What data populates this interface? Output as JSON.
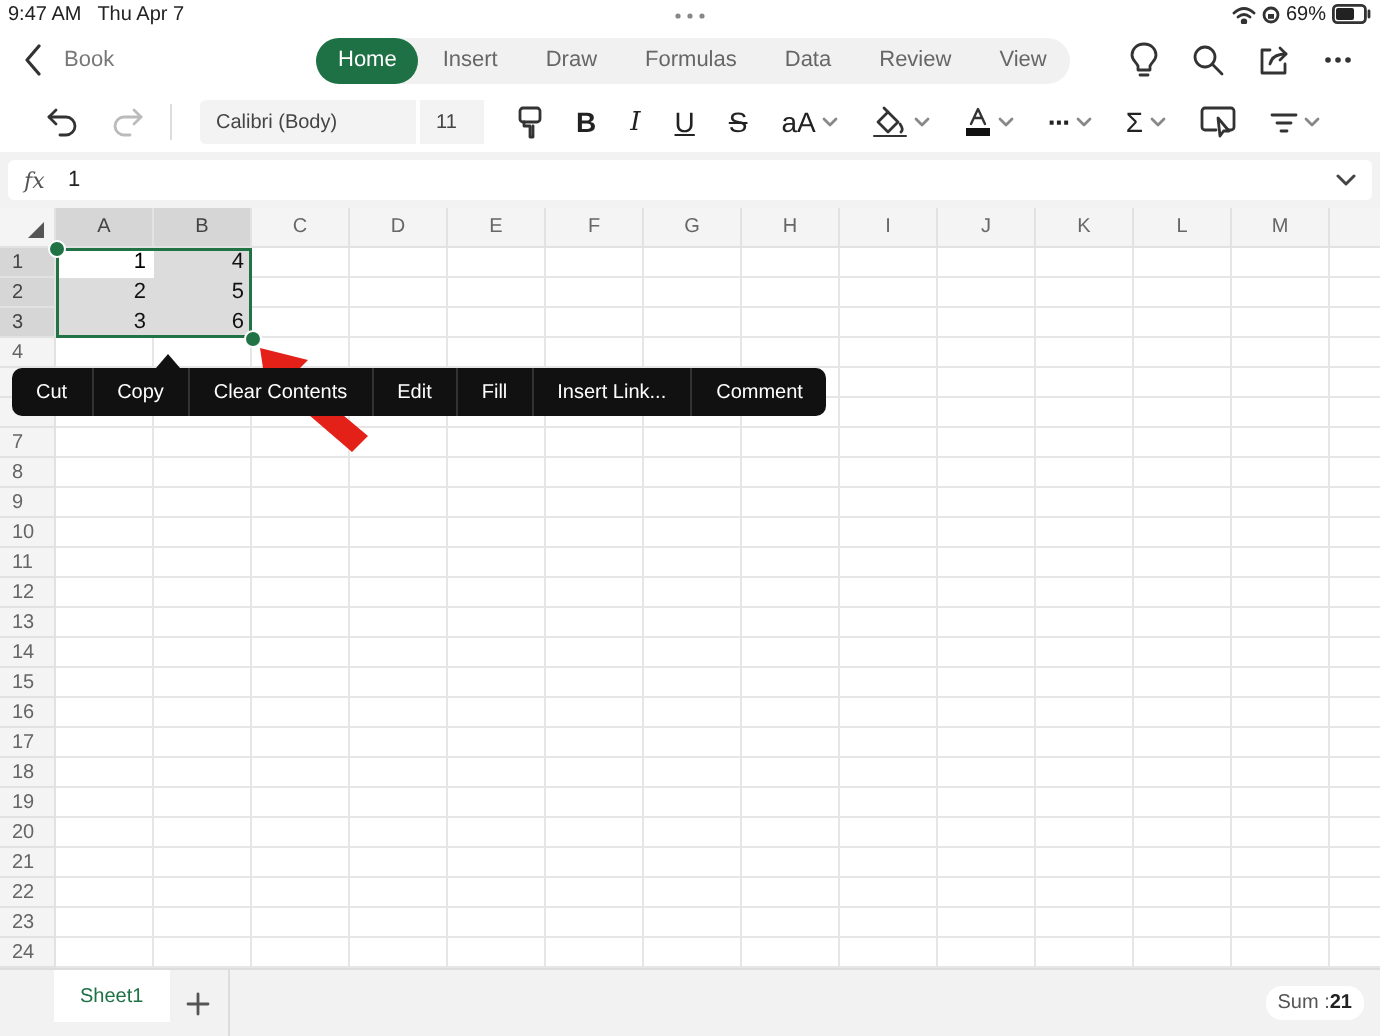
{
  "status_bar": {
    "time": "9:47 AM",
    "date": "Thu Apr 7",
    "battery": "69%"
  },
  "header": {
    "back_label": "Book",
    "tabs": [
      {
        "label": "Home",
        "selected": true
      },
      {
        "label": "Insert",
        "selected": false
      },
      {
        "label": "Draw",
        "selected": false
      },
      {
        "label": "Formulas",
        "selected": false
      },
      {
        "label": "Data",
        "selected": false
      },
      {
        "label": "Review",
        "selected": false
      },
      {
        "label": "View",
        "selected": false
      }
    ]
  },
  "toolbar": {
    "font": "Calibri (Body)",
    "size": "11",
    "items": [
      {
        "kind": "undo",
        "disabled": false
      },
      {
        "kind": "redo",
        "disabled": true
      },
      {
        "kind": "painter"
      },
      {
        "kind": "bold",
        "label": "B"
      },
      {
        "kind": "italic",
        "label": "I"
      },
      {
        "kind": "underline",
        "label": "U"
      },
      {
        "kind": "strike",
        "label": "S"
      },
      {
        "kind": "case",
        "label": "aA"
      },
      {
        "kind": "fill"
      },
      {
        "kind": "fontcolor"
      },
      {
        "kind": "more",
        "label": "···"
      },
      {
        "kind": "sum",
        "label": "Σ"
      },
      {
        "kind": "select"
      },
      {
        "kind": "filter"
      }
    ]
  },
  "formula_bar": {
    "label": "fx",
    "value": "1"
  },
  "sheet": {
    "columns": [
      {
        "label": "A",
        "selected": true
      },
      {
        "label": "B",
        "selected": true
      },
      {
        "label": "C",
        "selected": false
      },
      {
        "label": "D",
        "selected": false
      },
      {
        "label": "E",
        "selected": false
      },
      {
        "label": "F",
        "selected": false
      },
      {
        "label": "G",
        "selected": false
      },
      {
        "label": "H",
        "selected": false
      },
      {
        "label": "I",
        "selected": false
      },
      {
        "label": "J",
        "selected": false
      },
      {
        "label": "K",
        "selected": false
      },
      {
        "label": "L",
        "selected": false
      },
      {
        "label": "M",
        "selected": false
      }
    ],
    "rows": [
      {
        "header": "1",
        "selected": true,
        "cells": [
          {
            "value": "1",
            "active": true
          },
          {
            "value": "4",
            "active": false
          }
        ]
      },
      {
        "header": "2",
        "selected": true,
        "cells": [
          {
            "value": "2",
            "active": false
          },
          {
            "value": "5",
            "active": false
          }
        ]
      },
      {
        "header": "3",
        "selected": true,
        "cells": [
          {
            "value": "3",
            "active": false
          },
          {
            "value": "6",
            "active": false
          }
        ]
      },
      {
        "header": "4",
        "selected": false
      },
      {
        "selected": false
      },
      {
        "selected": false
      },
      {
        "header": "7",
        "selected": false
      },
      {
        "header": "8",
        "selected": false
      },
      {
        "header": "9",
        "selected": false
      },
      {
        "header": "10",
        "selected": false
      },
      {
        "header": "11",
        "selected": false
      },
      {
        "header": "12",
        "selected": false
      },
      {
        "header": "13",
        "selected": false
      },
      {
        "header": "14",
        "selected": false
      },
      {
        "header": "15",
        "selected": false
      },
      {
        "header": "16",
        "selected": false
      },
      {
        "header": "17",
        "selected": false
      },
      {
        "header": "18",
        "selected": false
      },
      {
        "header": "19",
        "selected": false
      },
      {
        "header": "20",
        "selected": false
      },
      {
        "header": "21",
        "selected": false
      },
      {
        "header": "22",
        "selected": false
      },
      {
        "header": "23",
        "selected": false
      },
      {
        "header": "24",
        "selected": false
      }
    ]
  },
  "context_menu": {
    "items": [
      "Cut",
      "Copy",
      "Clear Contents",
      "Edit",
      "Fill",
      "Insert Link...",
      "Comment"
    ]
  },
  "sheet_tabs": [
    {
      "label": "Sheet1",
      "selected": true
    }
  ],
  "summary": "Sum :**21**"
}
